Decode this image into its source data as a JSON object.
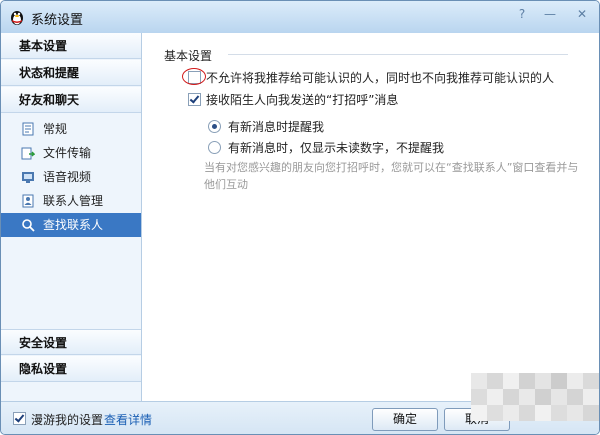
{
  "window": {
    "title": "系统设置",
    "icon": "qq-penguin-icon"
  },
  "sidebar": {
    "sections": [
      {
        "label": "基本设置"
      },
      {
        "label": "状态和提醒"
      },
      {
        "label": "好友和聊天"
      }
    ],
    "items": [
      {
        "label": "常规",
        "icon": "settings-page-icon"
      },
      {
        "label": "文件传输",
        "icon": "file-transfer-icon"
      },
      {
        "label": "语音视频",
        "icon": "video-call-icon"
      },
      {
        "label": "联系人管理",
        "icon": "contacts-icon"
      },
      {
        "label": "查找联系人",
        "icon": "search-contact-icon",
        "selected": true
      }
    ],
    "bottom_sections": [
      {
        "label": "安全设置"
      },
      {
        "label": "隐私设置"
      }
    ]
  },
  "main": {
    "section_title": "基本设置",
    "options": [
      {
        "label": "不允许将我推荐给可能认识的人，同时也不向我推荐可能认识的人",
        "checked": false
      },
      {
        "label": "接收陌生人向我发送的“打招呼”消息",
        "checked": true
      }
    ],
    "radios": [
      {
        "label": "有新消息时提醒我",
        "checked": true
      },
      {
        "label": "有新消息时，仅显示未读数字，不提醒我",
        "checked": false
      }
    ],
    "hint": "当有对您感兴趣的朋友向您打招呼时，您就可以在“查找联系人”窗口查看并与他们互动"
  },
  "footer": {
    "roam_label": "漫游我的设置",
    "roam_checked": true,
    "details_link": "查看详情",
    "ok_label": "确定",
    "cancel_label": "取消"
  },
  "colors": {
    "accent": "#3a78c4",
    "link": "#1a5fb4",
    "highlight_circle": "#d21a1a"
  }
}
